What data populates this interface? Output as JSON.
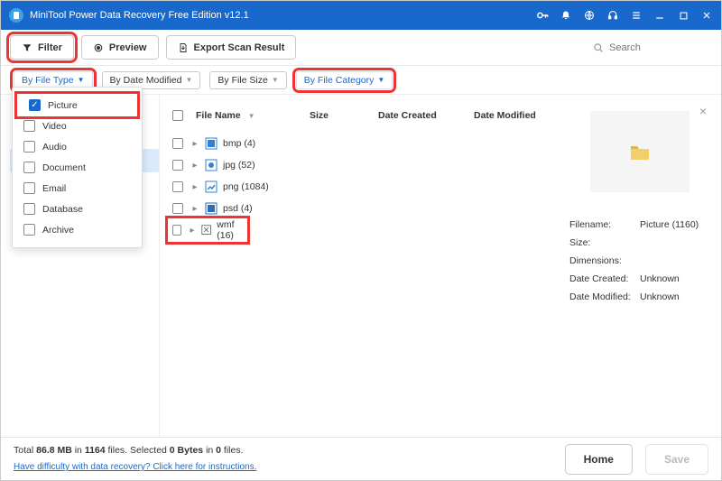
{
  "title": "MiniTool Power Data Recovery Free Edition v12.1",
  "toolbar": {
    "filter": "Filter",
    "preview": "Preview",
    "export": "Export Scan Result",
    "search_placeholder": "Search"
  },
  "filterbar": {
    "by_type": "By File Type",
    "by_date": "By Date Modified",
    "by_size": "By File Size",
    "by_category": "By File Category"
  },
  "type_dropdown": {
    "items": [
      {
        "label": "Picture",
        "checked": true
      },
      {
        "label": "Video",
        "checked": false
      },
      {
        "label": "Audio",
        "checked": false
      },
      {
        "label": "Document",
        "checked": false
      },
      {
        "label": "Email",
        "checked": false
      },
      {
        "label": "Database",
        "checked": false
      },
      {
        "label": "Archive",
        "checked": false
      }
    ]
  },
  "columns": {
    "name": "File Name",
    "size": "Size",
    "created": "Date Created",
    "modified": "Date Modified"
  },
  "rows": [
    {
      "label": "bmp (4)"
    },
    {
      "label": "jpg (52)"
    },
    {
      "label": "png (1084)"
    },
    {
      "label": "psd (4)"
    },
    {
      "label": "wmf (16)"
    }
  ],
  "preview": {
    "filename_label": "Filename:",
    "filename_value": "Picture (1160)",
    "size_label": "Size:",
    "dimensions_label": "Dimensions:",
    "created_label": "Date Created:",
    "created_value": "Unknown",
    "modified_label": "Date Modified:",
    "modified_value": "Unknown"
  },
  "status": {
    "line1_pre": "Total ",
    "line1_mb": "86.8 MB",
    "line1_mid": " in ",
    "line1_files": "1164",
    "line1_post": " files.    Selected ",
    "line1_bytes": "0 Bytes",
    "line1_in": " in ",
    "line1_sel": "0",
    "line1_end": " files.",
    "help": "Have difficulty with data recovery? Click here for instructions.",
    "home": "Home",
    "save": "Save"
  }
}
